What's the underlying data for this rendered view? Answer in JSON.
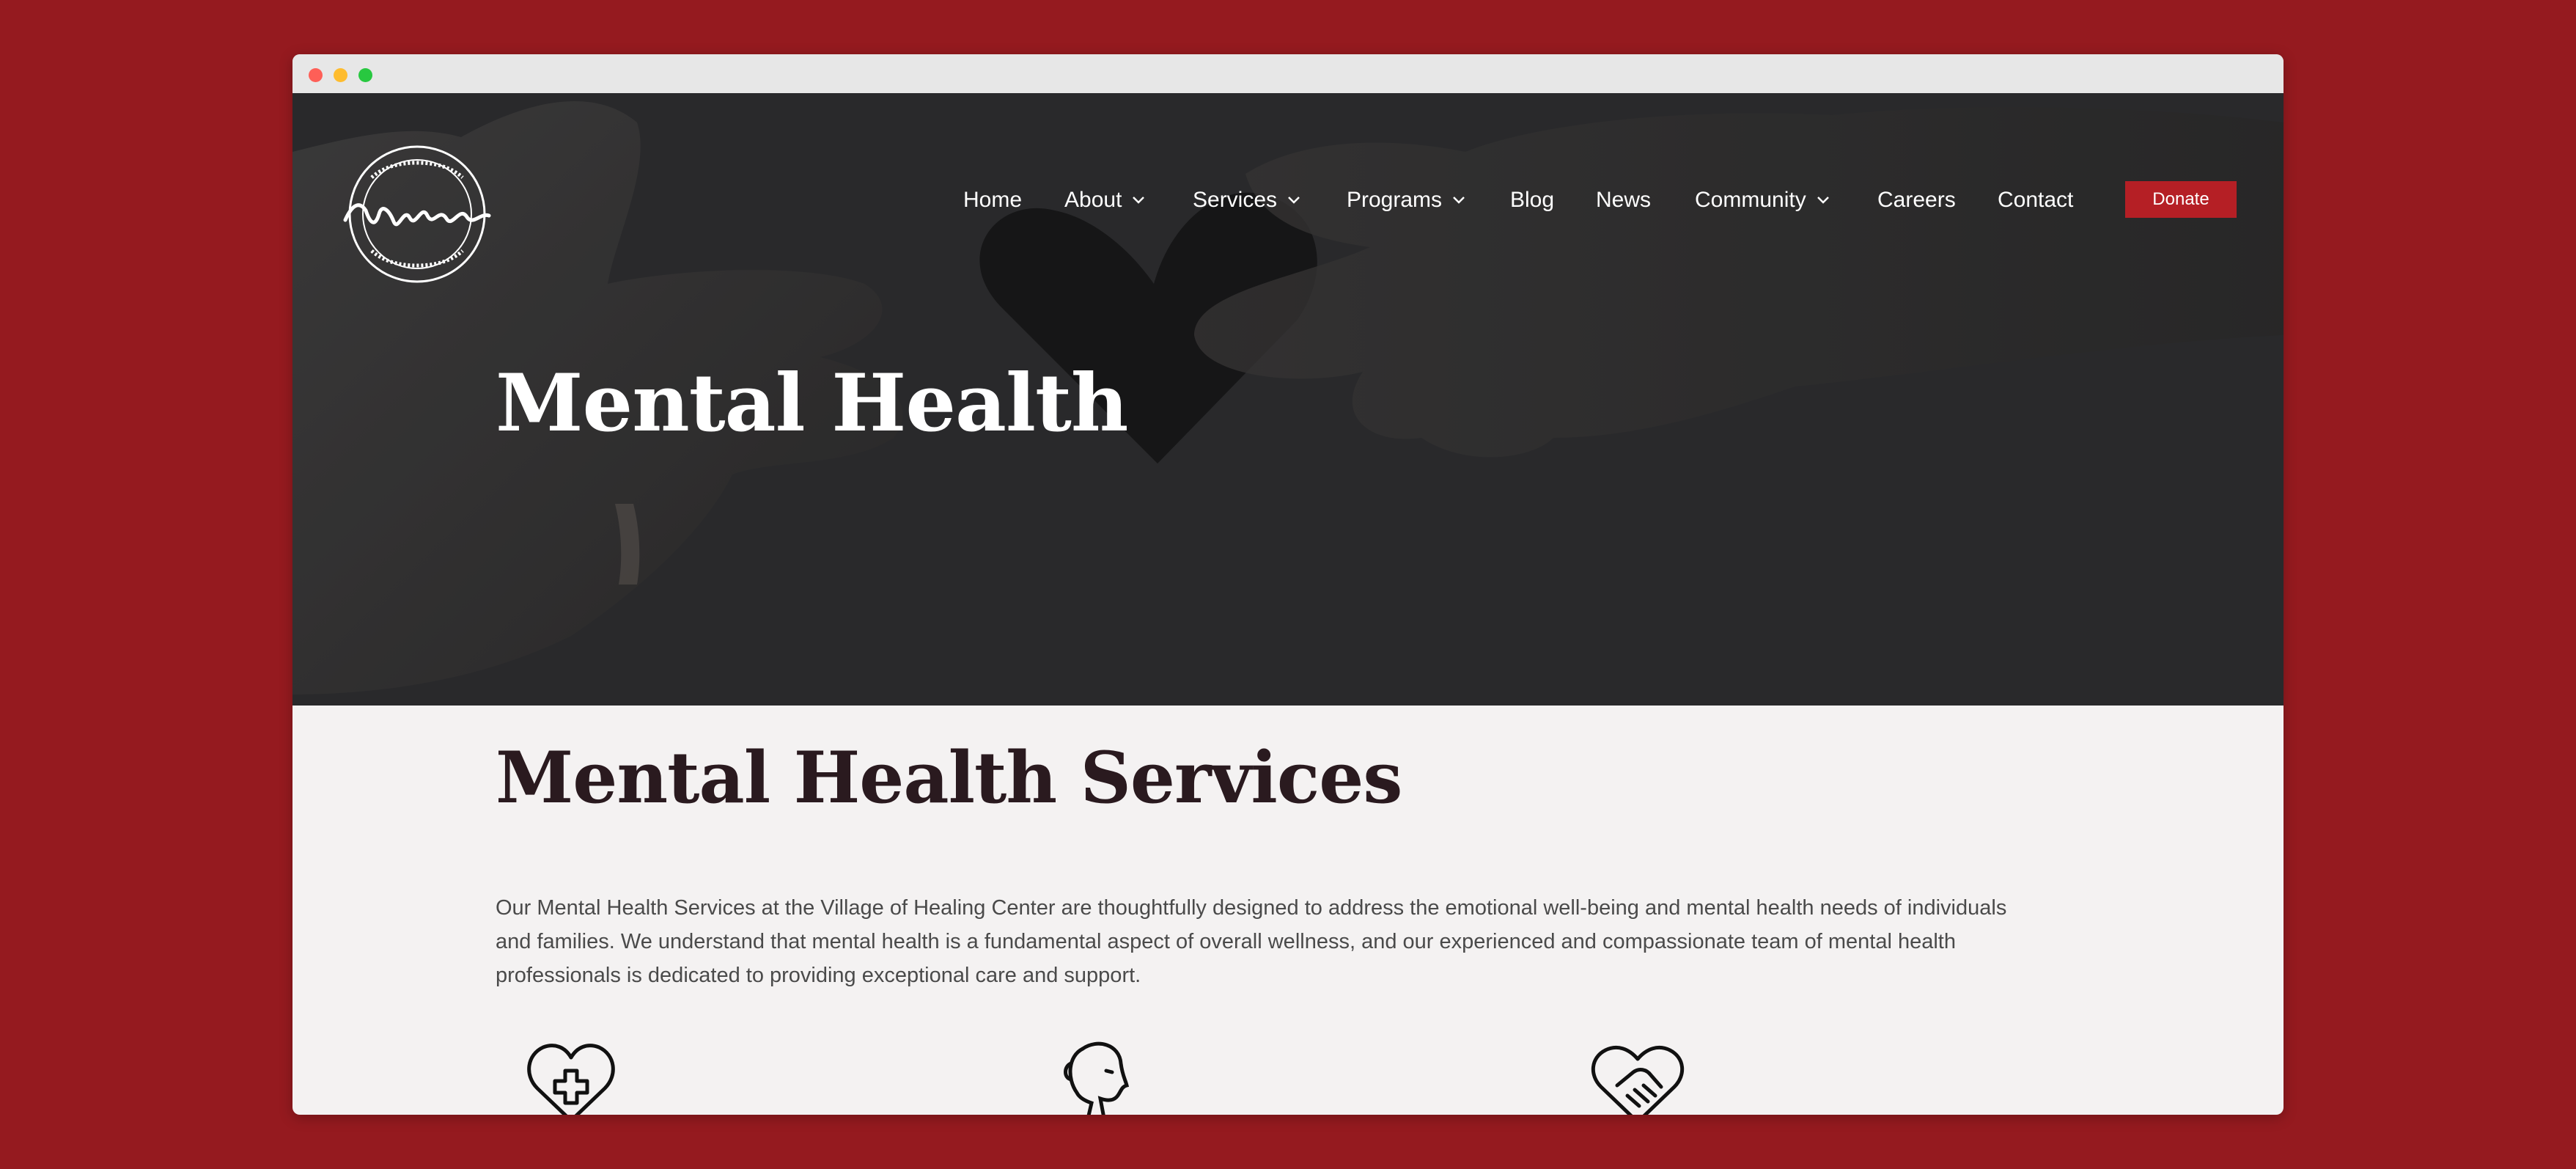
{
  "window": {
    "controls": [
      "close",
      "minimize",
      "maximize"
    ]
  },
  "site": {
    "logo_text": "Village of Healing",
    "logo_ring_text": "STRENGTHENING OUR COMMUNITY THROUGH HEALTH AND WELLNESS"
  },
  "nav": {
    "items": [
      {
        "label": "Home",
        "has_dropdown": false
      },
      {
        "label": "About",
        "has_dropdown": true
      },
      {
        "label": "Services",
        "has_dropdown": true
      },
      {
        "label": "Programs",
        "has_dropdown": true
      },
      {
        "label": "Blog",
        "has_dropdown": false
      },
      {
        "label": "News",
        "has_dropdown": false
      },
      {
        "label": "Community",
        "has_dropdown": true
      },
      {
        "label": "Careers",
        "has_dropdown": false
      },
      {
        "label": "Contact",
        "has_dropdown": false
      }
    ],
    "donate_label": "Donate"
  },
  "hero": {
    "title": "Mental Health"
  },
  "main": {
    "section_title": "Mental Health Services",
    "intro": "Our Mental Health Services at the Village of Healing Center are thoughtfully designed to address the emotional well-being and mental health needs of individuals and families. We understand that mental health is a fundamental aspect of overall wellness, and our experienced and compassionate team of mental health professionals is dedicated to providing exceptional care and support.",
    "feature_icons": [
      "heart-plus-icon",
      "person-profile-icon",
      "heart-handshake-icon"
    ]
  },
  "colors": {
    "page_background": "#951a1f",
    "accent": "#b51f25",
    "hero_overlay": "#2b2c2e",
    "heading": "#2a1a1f",
    "body_text": "#4a4a4a"
  }
}
